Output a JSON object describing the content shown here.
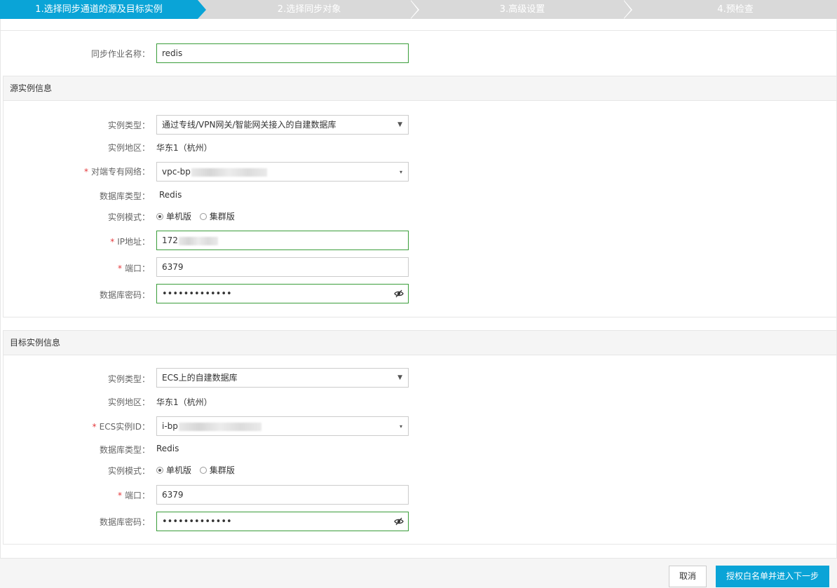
{
  "steps": [
    {
      "label": "1.选择同步通道的源及目标实例",
      "active": true
    },
    {
      "label": "2.选择同步对象",
      "active": false
    },
    {
      "label": "3.高级设置",
      "active": false
    },
    {
      "label": "4.预检查",
      "active": false
    }
  ],
  "colors": {
    "active_step": "#0aa4d7",
    "inactive_step": "#d9d9d9",
    "required": "#e4393c",
    "valid_border": "#3a9d3a"
  },
  "job": {
    "label": "同步作业名称：",
    "value": "redis"
  },
  "source": {
    "title": "源实例信息",
    "instance_type": {
      "label": "实例类型：",
      "value": "通过专线/VPN网关/智能网关接入的自建数据库"
    },
    "region": {
      "label": "实例地区：",
      "value": "华东1（杭州）"
    },
    "vpc": {
      "label": "对端专有网络：",
      "value": "vpc-bp"
    },
    "db_type": {
      "label": "数据库类型：",
      "value": "Redis"
    },
    "mode": {
      "label": "实例模式：",
      "options": [
        "单机版",
        "集群版"
      ],
      "selected": "单机版"
    },
    "ip": {
      "label": "IP地址：",
      "value": "172"
    },
    "port": {
      "label": "端口：",
      "value": "6379"
    },
    "password": {
      "label": "数据库密码：",
      "value": "•••••••••••••"
    }
  },
  "target": {
    "title": "目标实例信息",
    "instance_type": {
      "label": "实例类型：",
      "value": "ECS上的自建数据库"
    },
    "region": {
      "label": "实例地区：",
      "value": "华东1（杭州）"
    },
    "ecs_id": {
      "label": "ECS实例ID：",
      "value": "i-bp"
    },
    "db_type": {
      "label": "数据库类型：",
      "value": "Redis"
    },
    "mode": {
      "label": "实例模式：",
      "options": [
        "单机版",
        "集群版"
      ],
      "selected": "单机版"
    },
    "port": {
      "label": "端口：",
      "value": "6379"
    },
    "password": {
      "label": "数据库密码：",
      "value": "•••••••••••••"
    }
  },
  "footer": {
    "cancel": "取消",
    "next": "授权白名单并进入下一步"
  },
  "icons": {
    "select_caret": "▼",
    "dropdown_caret": "▾",
    "eye": "eye-slash-icon",
    "required_mark": "*"
  }
}
